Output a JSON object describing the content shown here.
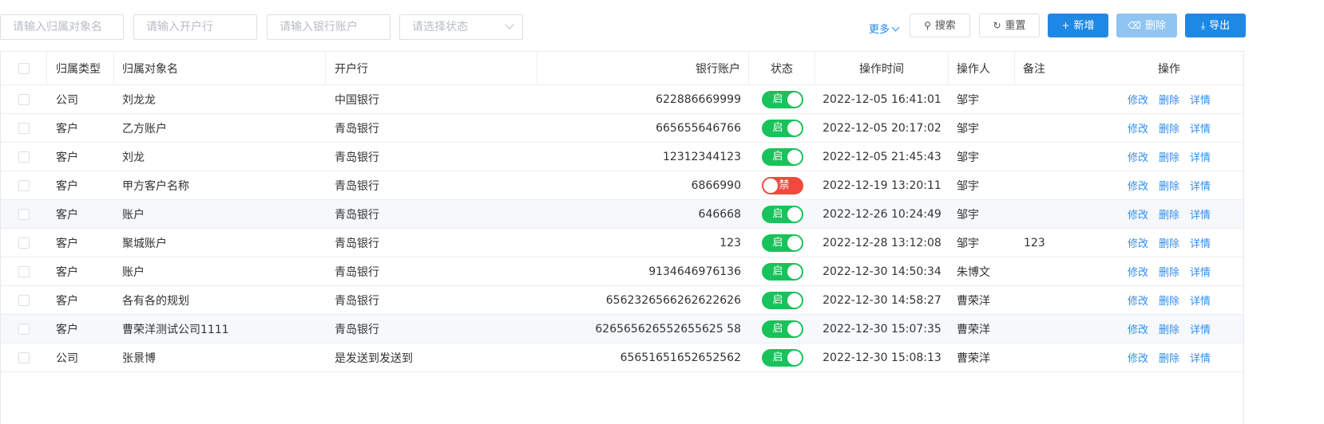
{
  "filters": {
    "owner_name_placeholder": "请输入归属对象名",
    "bank_placeholder": "请输入开户行",
    "account_placeholder": "请输入银行账户",
    "status_placeholder": "请选择状态"
  },
  "toolbar": {
    "more_label": "更多",
    "search_label": "搜索",
    "reset_label": "重置",
    "add_label": "新增",
    "delete_label": "删除",
    "export_label": "导出"
  },
  "table": {
    "headers": {
      "owner_type": "归属类型",
      "owner_name": "归属对象名",
      "bank": "开户行",
      "account": "银行账户",
      "status": "状态",
      "op_time": "操作时间",
      "operator": "操作人",
      "remark": "备注",
      "actions": "操作"
    },
    "action_labels": {
      "edit": "修改",
      "delete": "删除",
      "detail": "详情"
    },
    "status_labels": {
      "on": "启",
      "off": "禁"
    },
    "rows": [
      {
        "owner_type": "公司",
        "owner_name": "刘龙龙",
        "bank": "中国银行",
        "account": "622886669999",
        "status": "on",
        "op_time": "2022-12-05 16:41:01",
        "operator": "邹宇",
        "remark": ""
      },
      {
        "owner_type": "客户",
        "owner_name": "乙方账户",
        "bank": "青岛银行",
        "account": "665655646766",
        "status": "on",
        "op_time": "2022-12-05 20:17:02",
        "operator": "邹宇",
        "remark": ""
      },
      {
        "owner_type": "客户",
        "owner_name": "刘龙",
        "bank": "青岛银行",
        "account": "12312344123",
        "status": "on",
        "op_time": "2022-12-05 21:45:43",
        "operator": "邹宇",
        "remark": ""
      },
      {
        "owner_type": "客户",
        "owner_name": "甲方客户名称",
        "bank": "青岛银行",
        "account": "6866990",
        "status": "off",
        "op_time": "2022-12-19 13:20:11",
        "operator": "邹宇",
        "remark": ""
      },
      {
        "owner_type": "客户",
        "owner_name": "账户",
        "bank": "青岛银行",
        "account": "646668",
        "status": "on",
        "op_time": "2022-12-26 10:24:49",
        "operator": "邹宇",
        "remark": ""
      },
      {
        "owner_type": "客户",
        "owner_name": "聚城账户",
        "bank": "青岛银行",
        "account": "123",
        "status": "on",
        "op_time": "2022-12-28 13:12:08",
        "operator": "邹宇",
        "remark": "123"
      },
      {
        "owner_type": "客户",
        "owner_name": "账户",
        "bank": "青岛银行",
        "account": "9134646976136",
        "status": "on",
        "op_time": "2022-12-30 14:50:34",
        "operator": "朱博文",
        "remark": ""
      },
      {
        "owner_type": "客户",
        "owner_name": "各有各的规划",
        "bank": "青岛银行",
        "account": "6562326566262622626",
        "status": "on",
        "op_time": "2022-12-30 14:58:27",
        "operator": "曹荣洋",
        "remark": ""
      },
      {
        "owner_type": "客户",
        "owner_name": "曹荣洋测试公司1111",
        "bank": "青岛银行",
        "account": "626565626552655625 58",
        "status": "on",
        "op_time": "2022-12-30 15:07:35",
        "operator": "曹荣洋",
        "remark": ""
      },
      {
        "owner_type": "公司",
        "owner_name": "张景博",
        "bank": "是发送到发送到",
        "account": "65651651652652562",
        "status": "on",
        "op_time": "2022-12-30 15:08:13",
        "operator": "曹荣洋",
        "remark": ""
      }
    ]
  },
  "colors": {
    "primary": "#1e88e5",
    "switch_on": "#17c35a",
    "switch_off": "#f2493e",
    "link": "#2f8ef0"
  }
}
